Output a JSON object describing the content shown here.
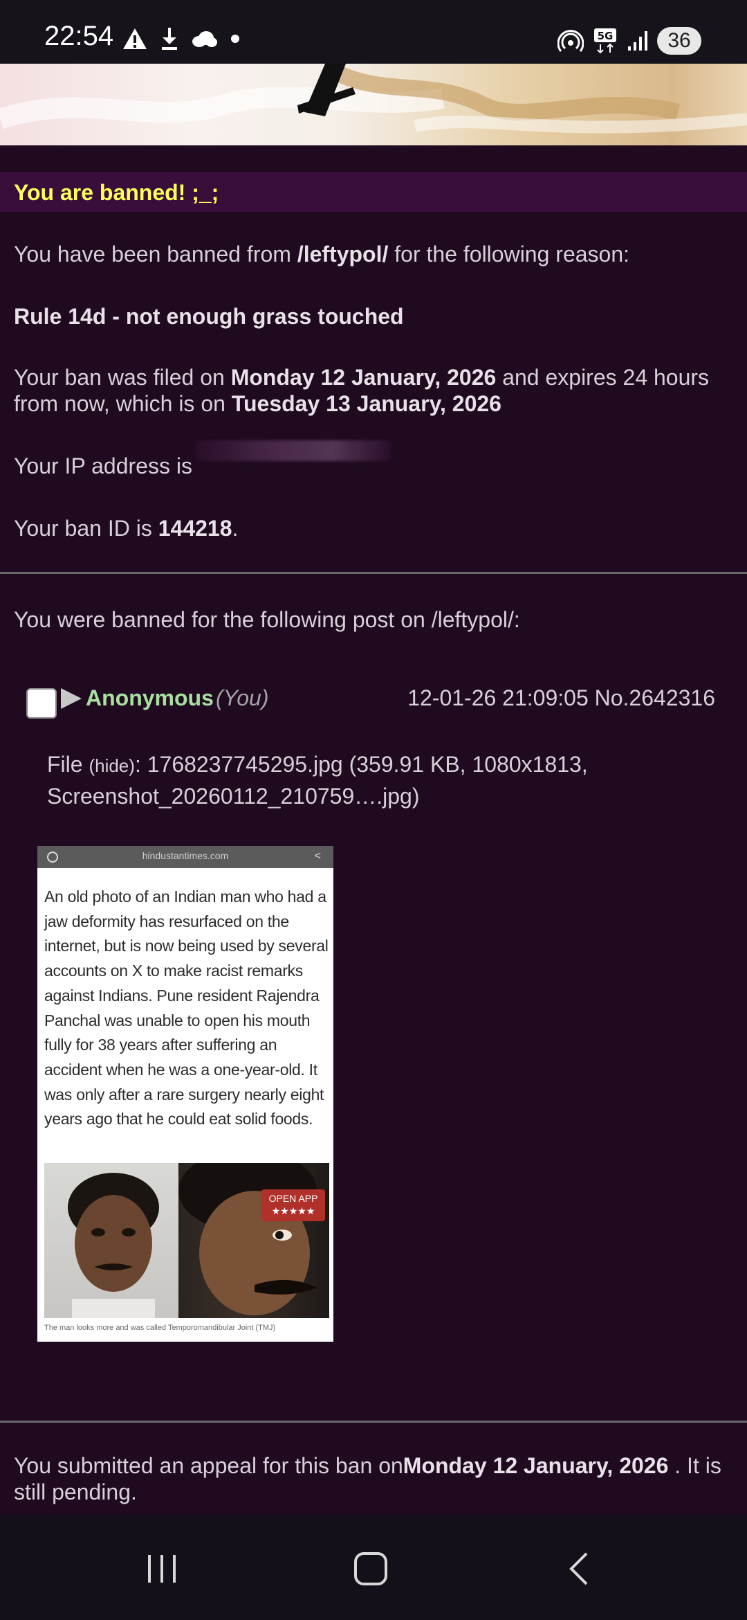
{
  "status_bar": {
    "time": "22:54",
    "left_icons": [
      "alert-triangle-icon",
      "download-icon",
      "cloud-icon",
      "dot-icon"
    ],
    "right_icons": [
      "hotspot-icon",
      "5g-icon",
      "signal-icon"
    ],
    "battery": "36"
  },
  "ban": {
    "header": "You are banned! ;_;",
    "intro_prefix": "You have been banned from ",
    "board": "/leftypol/",
    "intro_suffix": " for the following reason:",
    "reason": "Rule 14d - not enough grass touched",
    "filed_prefix": "Your ban was filed on ",
    "filed_date": "Monday 12 January, 2026",
    "filed_mid": " and expires 24 hours from now, which is on ",
    "expires_date": "Tuesday 13 January, 2026",
    "ip_prefix": "Your IP address is",
    "id_prefix": "Your ban ID is ",
    "ban_id": "144218",
    "id_suffix": "."
  },
  "post": {
    "intro": "You were banned for the following post on /leftypol/:",
    "name": "Anonymous",
    "you": "(You)",
    "datetime": "12-01-26 21:09:05",
    "number": "No.2642316",
    "file_label": "File",
    "hide_label": "(hide)",
    "file_details": ": 1768237745295.jpg (359.91 KB, 1080x1813, Screenshot_20260112_210759….jpg)"
  },
  "thumbnail": {
    "url": "hindustantimes.com",
    "article_text": "An old photo of an Indian man who had a jaw deformity has resurfaced on the internet, but is now being used by several accounts on X to make racist remarks against Indians. Pune resident Rajendra Panchal was unable to open his mouth fully for 38 years after suffering an accident when he was a one-year-old. It was only after a rare surgery nearly eight years ago that he could eat solid foods.",
    "open_app": "OPEN APP",
    "stars": "★★★★★",
    "caption": "The man looks more and was called Temporomandibular Joint (TMJ)"
  },
  "appeal": {
    "prefix": "You submitted an appeal for this ban on",
    "date": "Monday 12 January, 2026",
    "suffix": " . It is still pending."
  },
  "nav_bar": {
    "buttons": [
      "recent-apps-icon",
      "home-icon",
      "back-icon"
    ]
  },
  "colors": {
    "background": "#1f0a1f",
    "header_bg": "#3a0e3a",
    "header_text": "#ffff5c",
    "name_green": "#a8e0a0"
  }
}
